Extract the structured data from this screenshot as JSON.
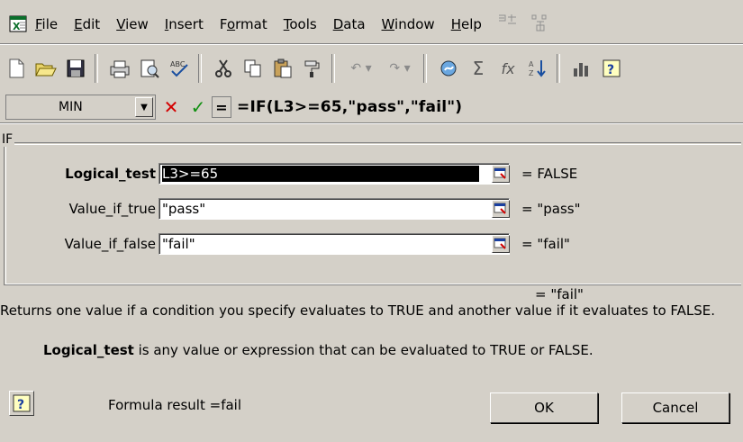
{
  "menu": {
    "items": [
      {
        "label": "File",
        "accel": "F",
        "rest": "ile"
      },
      {
        "label": "Edit",
        "accel": "E",
        "rest": "dit"
      },
      {
        "label": "View",
        "accel": "V",
        "rest": "iew"
      },
      {
        "label": "Insert",
        "accel": "I",
        "rest": "nsert"
      },
      {
        "label": "Format",
        "pre": "F",
        "accel": "o",
        "rest": "rmat"
      },
      {
        "label": "Tools",
        "accel": "T",
        "rest": "ools"
      },
      {
        "label": "Data",
        "accel": "D",
        "rest": "ata"
      },
      {
        "label": "Window",
        "accel": "W",
        "rest": "indow"
      },
      {
        "label": "Help",
        "accel": "H",
        "rest": "elp"
      }
    ]
  },
  "toolbar": {
    "icons": [
      "new-icon",
      "open-icon",
      "save-icon",
      "print-icon",
      "print-preview-icon",
      "spelling-icon",
      "cut-icon",
      "copy-icon",
      "paste-icon",
      "format-painter-icon",
      "undo-icon",
      "redo-icon",
      "hyperlink-icon",
      "autosum-icon",
      "function-icon",
      "sort-ascending-icon",
      "chart-wizard-icon",
      "help-icon"
    ]
  },
  "formula_bar": {
    "name_box": "MIN",
    "cancel_symbol": "✕",
    "enter_symbol": "✓",
    "equals_symbol": "=",
    "formula": "=IF(L3>=65,\"pass\",\"fail\")"
  },
  "dialog": {
    "function_name": "IF",
    "args": [
      {
        "label": "Logical_test",
        "value": "L3>=65",
        "result": "= FALSE"
      },
      {
        "label": "Value_if_true",
        "value": "\"pass\"",
        "result": "= \"pass\""
      },
      {
        "label": "Value_if_false",
        "value": "\"fail\"",
        "result": "= \"fail\""
      }
    ],
    "overall_result": "= \"fail\"",
    "description": "Returns one value if a condition you specify evaluates to TRUE and another value if it evaluates to FALSE.",
    "arg_help_name": "Logical_test",
    "arg_help_text": " is any value or expression that can be evaluated to TRUE or FALSE.",
    "formula_result": "Formula result =fail",
    "ok_label": "OK",
    "cancel_label": "Cancel"
  }
}
